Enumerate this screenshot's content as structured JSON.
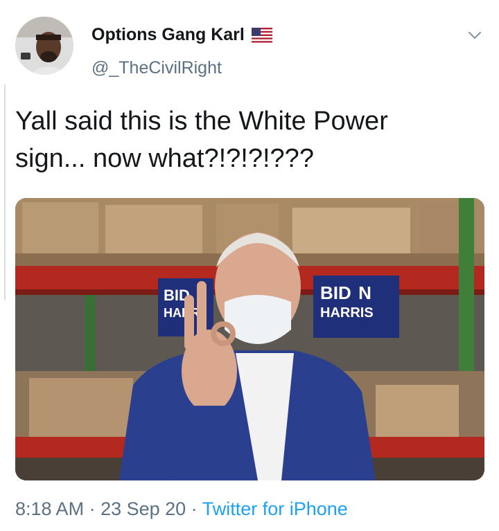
{
  "tweet": {
    "author": {
      "display_name": "Options Gang Karl",
      "handle": "@_TheCivilRight",
      "name_flag": "us-flag-icon"
    },
    "text": "Yall said this is the White Power\nsign... now what?!?!?!???",
    "media": {
      "signs": [
        {
          "line1": "BID",
          "line2": "HARR"
        },
        {
          "line1": "BID  N",
          "line2": "HARRIS"
        }
      ]
    },
    "meta": {
      "time": "8:18 AM",
      "separator": " · ",
      "date": "23 Sep 20",
      "source": "Twitter for iPhone"
    }
  },
  "colors": {
    "text_primary": "#14171a",
    "text_secondary": "#5b7083",
    "link": "#1da1f2",
    "sign_blue": "#1f2f7a",
    "shelf_red": "#b3281f"
  }
}
